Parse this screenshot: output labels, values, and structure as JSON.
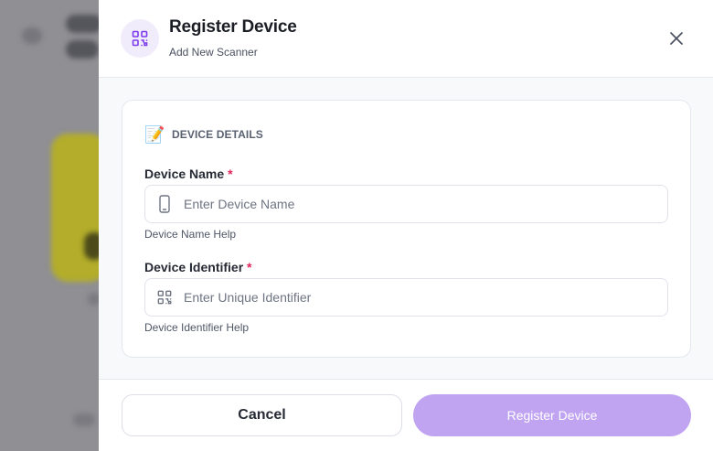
{
  "colors": {
    "accent": "#7c3aed",
    "accent_soft": "#f1ecfb",
    "primary_button_disabled": "#c0a4f1",
    "required": "#e0245e",
    "overlay": "#8f8f94"
  },
  "modal": {
    "title": "Register Device",
    "subtitle": "Add New Scanner",
    "header_icon": "qr-code-icon",
    "close_icon": "close-icon"
  },
  "section": {
    "emoji": "📝",
    "label": "DEVICE DETAILS"
  },
  "fields": {
    "device_name": {
      "label": "Device Name",
      "required_mark": "*",
      "placeholder": "Enter Device Name",
      "value": "",
      "help": "Device Name Help",
      "icon": "phone-icon"
    },
    "device_identifier": {
      "label": "Device Identifier",
      "required_mark": "*",
      "placeholder": "Enter Unique Identifier",
      "value": "",
      "help": "Device Identifier Help",
      "icon": "qr-code-icon"
    }
  },
  "footer": {
    "cancel_label": "Cancel",
    "submit_label": "Register Device"
  }
}
